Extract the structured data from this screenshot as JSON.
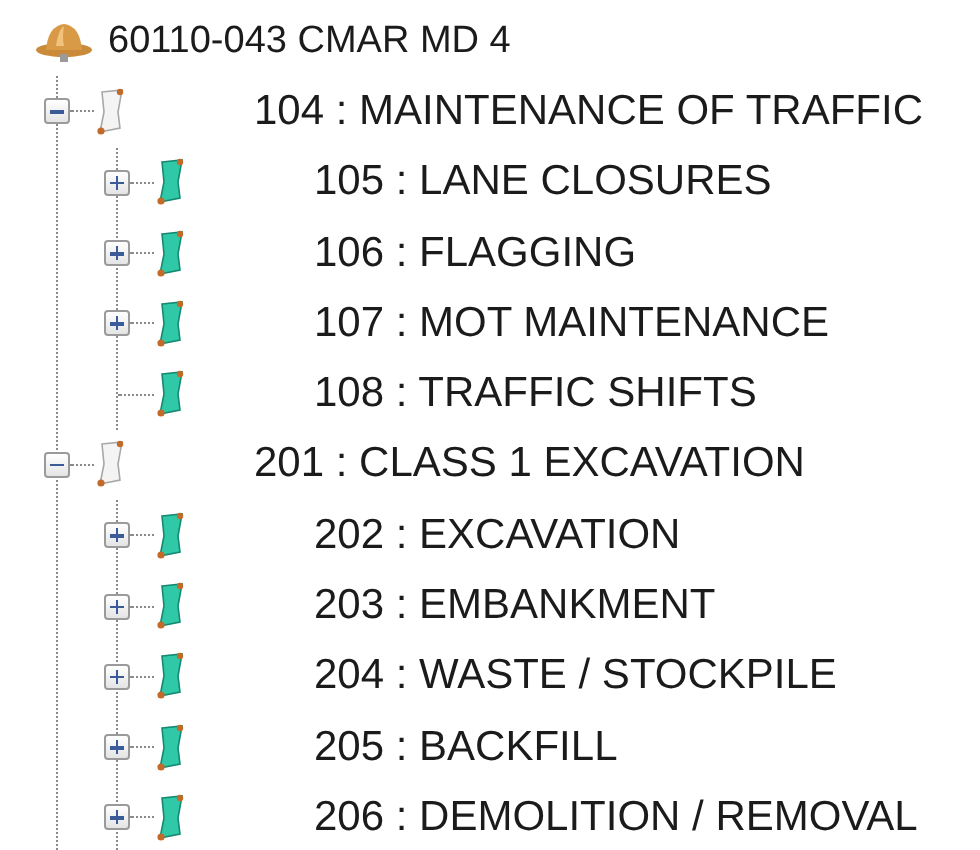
{
  "tree": {
    "label": "60110-043 CMAR MD 4",
    "kind": "project",
    "children": [
      {
        "label": "104 : MAINTENANCE OF TRAFFIC",
        "kind": "group",
        "expanded": true,
        "children": [
          {
            "label": "105 : LANE CLOSURES",
            "kind": "item",
            "expanded": false
          },
          {
            "label": "106 : FLAGGING",
            "kind": "item",
            "expanded": false
          },
          {
            "label": "107 : MOT MAINTENANCE",
            "kind": "item",
            "expanded": false
          },
          {
            "label": "108 : TRAFFIC SHIFTS",
            "kind": "item"
          }
        ]
      },
      {
        "label": "201 : CLASS 1 EXCAVATION",
        "kind": "group",
        "expanded": true,
        "children": [
          {
            "label": "202 : EXCAVATION",
            "kind": "item",
            "expanded": false
          },
          {
            "label": "203 : EMBANKMENT",
            "kind": "item",
            "expanded": false
          },
          {
            "label": "204 : WASTE / STOCKPILE",
            "kind": "item",
            "expanded": false
          },
          {
            "label": "205 : BACKFILL",
            "kind": "item",
            "expanded": false
          },
          {
            "label": "206 : DEMOLITION / REMOVAL",
            "kind": "item",
            "expanded": false
          }
        ]
      }
    ]
  }
}
